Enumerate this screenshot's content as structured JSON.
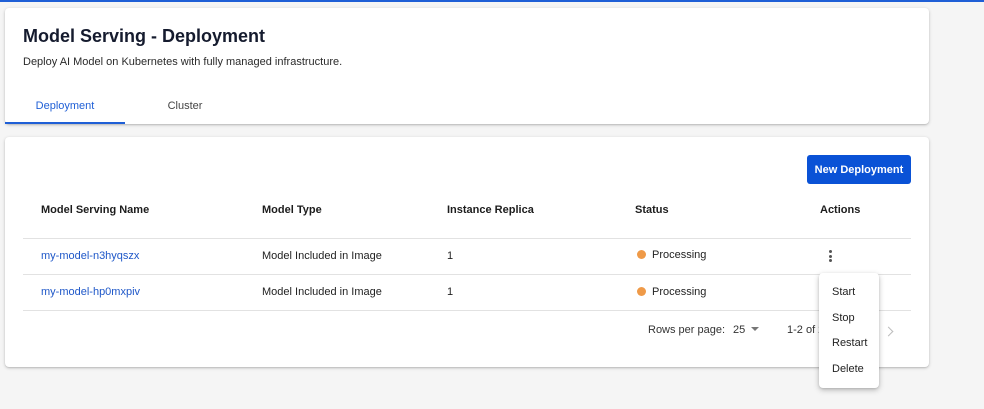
{
  "header": {
    "title": "Model Serving - Deployment",
    "subtitle": "Deploy AI Model on Kubernetes with fully managed infrastructure.",
    "tabs": [
      {
        "label": "Deployment",
        "active": true
      },
      {
        "label": "Cluster",
        "active": false
      }
    ]
  },
  "toolbar": {
    "new_deployment_label": "New Deployment"
  },
  "table": {
    "columns": [
      "Model Serving Name",
      "Model Type",
      "Instance Replica",
      "Status",
      "Actions"
    ],
    "rows": [
      {
        "name": "my-model-n3hyqszx",
        "model_type": "Model Included in Image",
        "replica": "1",
        "status": "Processing"
      },
      {
        "name": "my-model-hp0mxpiv",
        "model_type": "Model Included in Image",
        "replica": "1",
        "status": "Processing"
      }
    ]
  },
  "pagination": {
    "rows_per_page_label": "Rows per page:",
    "rows_per_page_value": "25",
    "range_label": "1-2 of 2"
  },
  "actions_menu": {
    "items": [
      "Start",
      "Stop",
      "Restart",
      "Delete"
    ]
  },
  "colors": {
    "accent": "#0a52d6",
    "status_processing": "#ef9a48"
  }
}
